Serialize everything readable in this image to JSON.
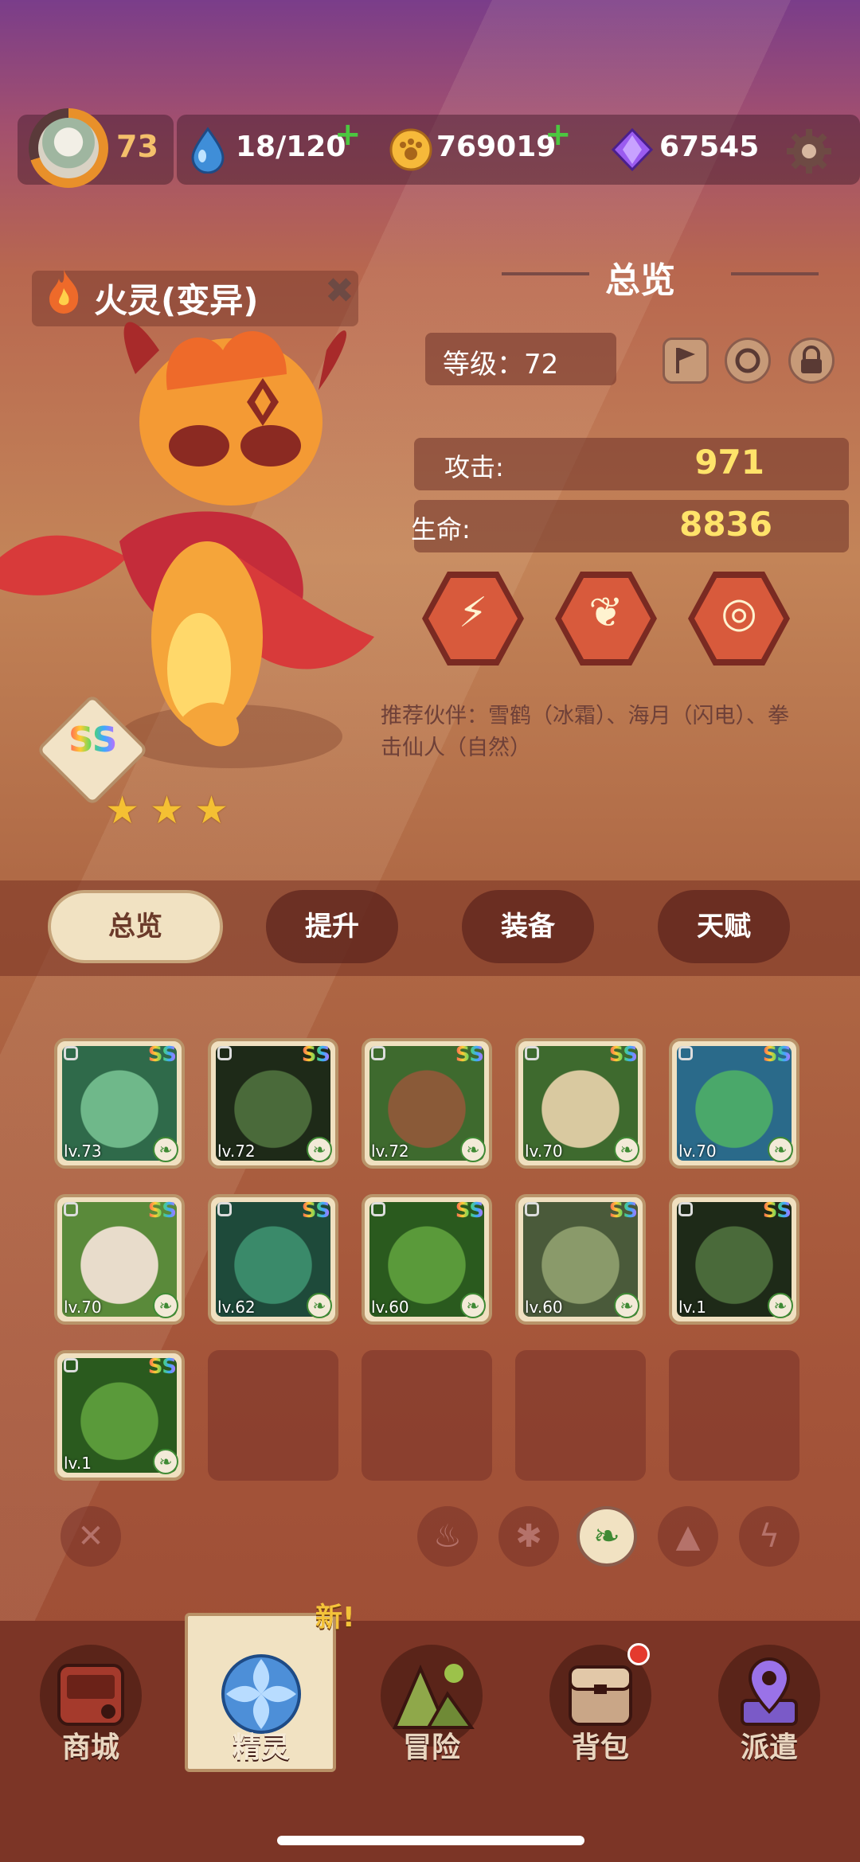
{
  "top_bar": {
    "player_level": "73",
    "stamina": "18/120",
    "coins": "769019",
    "gems": "67545",
    "icons": [
      "avatar",
      "water-drop-icon",
      "paw-coin-icon",
      "purple-gem-icon",
      "gear-icon"
    ]
  },
  "creature": {
    "name": "火灵(变异)",
    "rank": "SS",
    "stars": 3
  },
  "overview": {
    "title": "总览",
    "level": "等级：72",
    "attack_label": "攻击:",
    "attack_value": "971",
    "hp_label": "生命:",
    "hp_value": "8836",
    "recommend": "推荐伙伴：雪鹤（冰霜）、海月（闪电）、拳击仙人（自然）"
  },
  "tabs": [
    "总览",
    "提升",
    "装备",
    "天赋"
  ],
  "roster": [
    {
      "level": "lv.73",
      "rank": "SS"
    },
    {
      "level": "lv.72",
      "rank": "SS"
    },
    {
      "level": "lv.72",
      "rank": "SS"
    },
    {
      "level": "lv.70",
      "rank": "SS"
    },
    {
      "level": "lv.70",
      "rank": "SS"
    },
    {
      "level": "lv.70",
      "rank": "SS"
    },
    {
      "level": "lv.62",
      "rank": "SS"
    },
    {
      "level": "lv.60",
      "rank": "SS"
    },
    {
      "level": "lv.60",
      "rank": "SS"
    },
    {
      "level": "lv.1",
      "rank": "SS"
    },
    {
      "level": "lv.1",
      "rank": "SS"
    }
  ],
  "bottom_nav": {
    "items": [
      "商城",
      "精灵",
      "冒险",
      "背包",
      "派遣"
    ],
    "new_badge": "新!",
    "active": "精灵"
  },
  "colors": {
    "accent_gold": "#ffe36a",
    "nature_green": "#3f8a34"
  }
}
